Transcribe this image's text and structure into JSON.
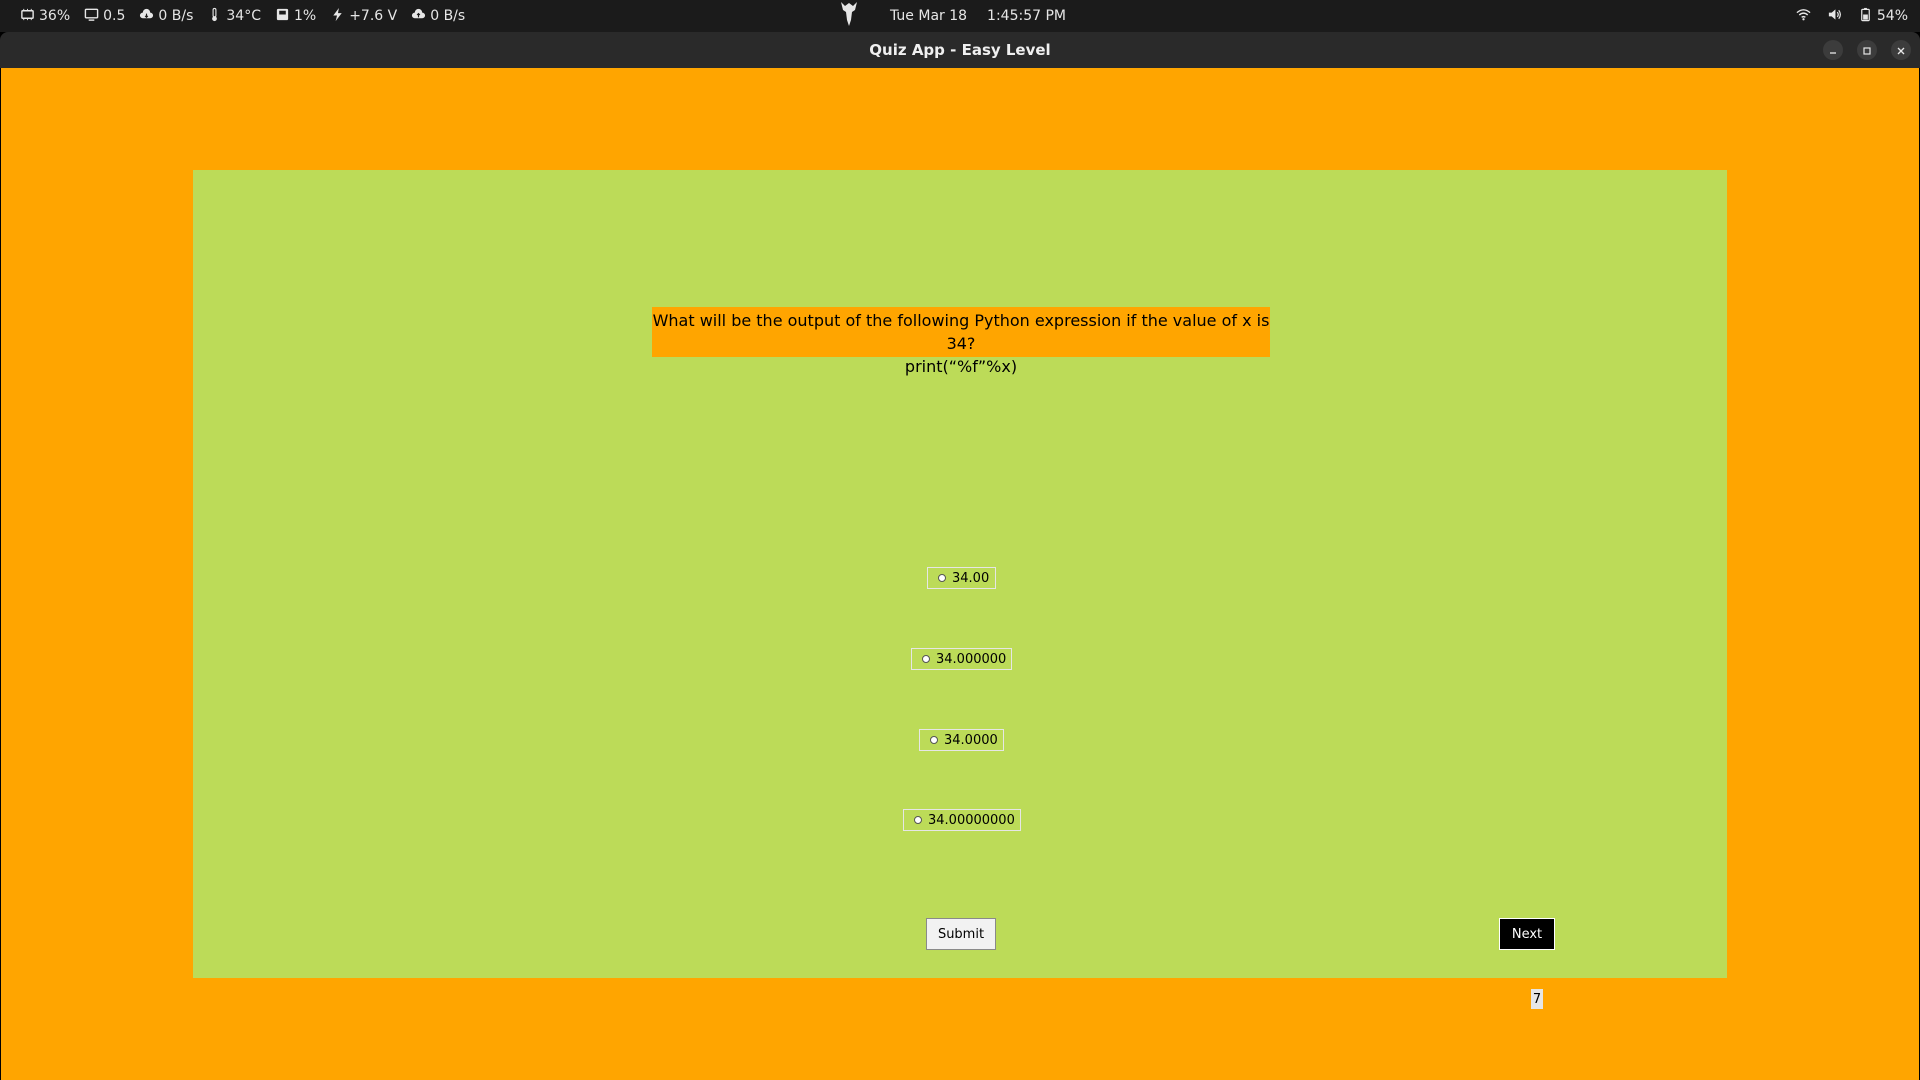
{
  "system_bar": {
    "stats": [
      {
        "icon": "cpu-icon",
        "value": "36%"
      },
      {
        "icon": "monitor-icon",
        "value": "0.5"
      },
      {
        "icon": "cloud-download-icon",
        "value": "0 B/s"
      },
      {
        "icon": "thermometer-icon",
        "value": "34°C"
      },
      {
        "icon": "disk-icon",
        "value": "1%"
      },
      {
        "icon": "lightning-icon",
        "value": "+7.6 V"
      },
      {
        "icon": "cloud-upload-icon",
        "value": "0 B/s"
      }
    ],
    "date": "Tue Mar 18",
    "time": "1:45:57 PM",
    "battery": "54%"
  },
  "window": {
    "title": "Quiz App - Easy Level"
  },
  "quiz": {
    "question_line1": "What will be the output of the following Python expression if the value of x is 34?",
    "question_line2": "print(“%f”%x)",
    "options": [
      "34.00",
      "34.000000",
      "34.0000",
      "34.00000000"
    ],
    "submit_label": "Submit",
    "next_label": "Next",
    "question_number": "7"
  },
  "colors": {
    "window_bg": "#ffa500",
    "panel_bg": "#bcdb58",
    "question_bg": "#ffa500"
  }
}
